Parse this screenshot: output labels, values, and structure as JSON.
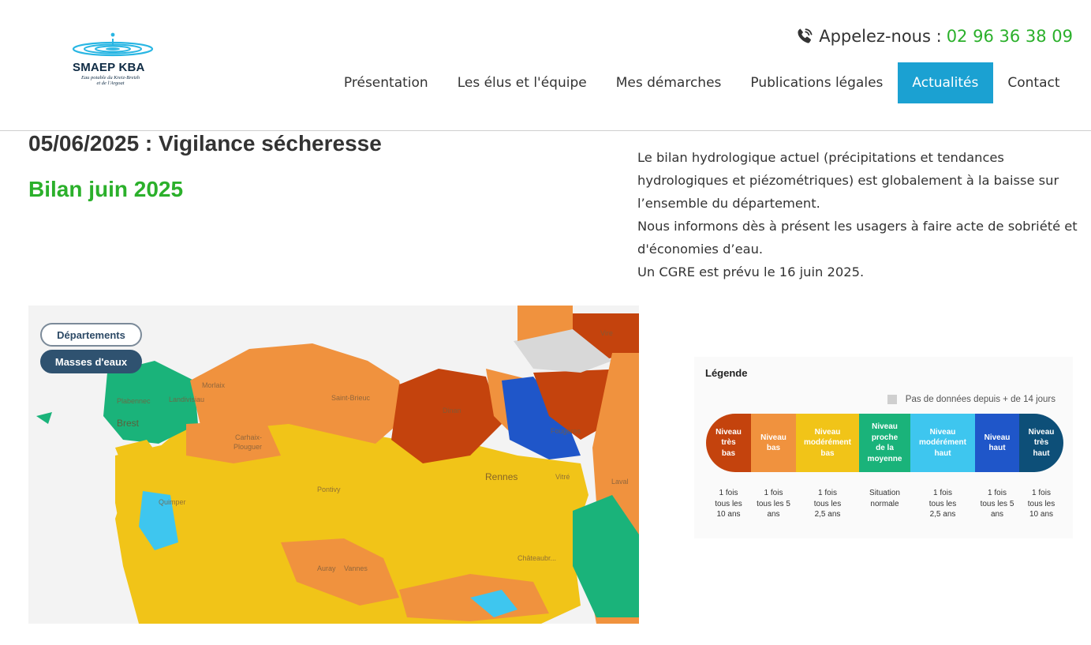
{
  "header": {
    "logo": {
      "title": "SMAEP KBA",
      "subtitle_line1": "Eau potable du Kreiz-Breizh",
      "subtitle_line2": "et de l'Argoat"
    },
    "phone": {
      "icon": "phone-icon",
      "label": "Appelez-nous :",
      "number": "02 96 36 38 09"
    },
    "nav": [
      {
        "label": "Présentation"
      },
      {
        "label": "Les élus et l'équipe"
      },
      {
        "label": "Mes démarches"
      },
      {
        "label": "Publications légales"
      },
      {
        "label": "Actualités",
        "active": true
      },
      {
        "label": "Contact"
      }
    ]
  },
  "article": {
    "title": "05/06/2025 : Vigilance sécheresse",
    "subtitle": "Bilan juin 2025",
    "paragraphs": [
      "Le bilan hydrologique actuel (précipitations et tendances",
      "hydrologiques et piézométriques) est globalement à la baisse sur",
      "l’ensemble du département.",
      "Nous informons dès à présent les usagers à faire acte de sobriété et",
      "d'économies d’eau.",
      "Un CGRE est prévu le 16 juin 2025."
    ]
  },
  "map": {
    "buttons": {
      "departements": "Départements",
      "masses": "Masses d'eaux"
    },
    "labels": {
      "brest": "Brest",
      "rennes": "Rennes",
      "quimper": "Quimper",
      "pontivy": "Pontivy",
      "vannes": "Vannes",
      "fougeres": "Fougères",
      "morlaix": "Morlaix",
      "vitre": "Vitré",
      "dinan": "Dinan",
      "carhaix": "Carhaix-",
      "plouguer": "Plouguer",
      "laval": "Laval",
      "vire": "Vire",
      "auray": "Auray",
      "chateaubriant": "Châteaubr...",
      "saint_brieuc": "Saint-Brieuc",
      "plabennec": "Plabennec",
      "landivisiau": "Landivisiau"
    }
  },
  "legend": {
    "title": "Légende",
    "no_data": "Pas de données depuis + de 14 jours",
    "colors": {
      "no_data": "#cfcfcf"
    },
    "levels": [
      {
        "label": [
          "Niveau",
          "très",
          "bas"
        ],
        "color": "#c4430d",
        "freq": [
          "1 fois",
          "tous les",
          "10 ans"
        ]
      },
      {
        "label": [
          "Niveau",
          "bas"
        ],
        "color": "#f0923e",
        "freq": [
          "1 fois",
          "tous les 5",
          "ans"
        ]
      },
      {
        "label": [
          "Niveau",
          "modérément",
          "bas"
        ],
        "color": "#f1c418",
        "freq": [
          "1 fois",
          "tous les",
          "2,5 ans"
        ]
      },
      {
        "label": [
          "Niveau",
          "proche",
          "de la",
          "moyenne"
        ],
        "color": "#1ab37a",
        "freq": [
          "Situation",
          "normale"
        ]
      },
      {
        "label": [
          "Niveau",
          "modérément",
          "haut"
        ],
        "color": "#3ec6ef",
        "freq": [
          "1 fois",
          "tous les",
          "2,5 ans"
        ]
      },
      {
        "label": [
          "Niveau",
          "haut"
        ],
        "color": "#1f56c9",
        "freq": [
          "1 fois",
          "tous les 5",
          "ans"
        ]
      },
      {
        "label": [
          "Niveau",
          "très",
          "haut"
        ],
        "color": "#0d4f78",
        "freq": [
          "1 fois",
          "tous les",
          "10 ans"
        ]
      }
    ]
  }
}
